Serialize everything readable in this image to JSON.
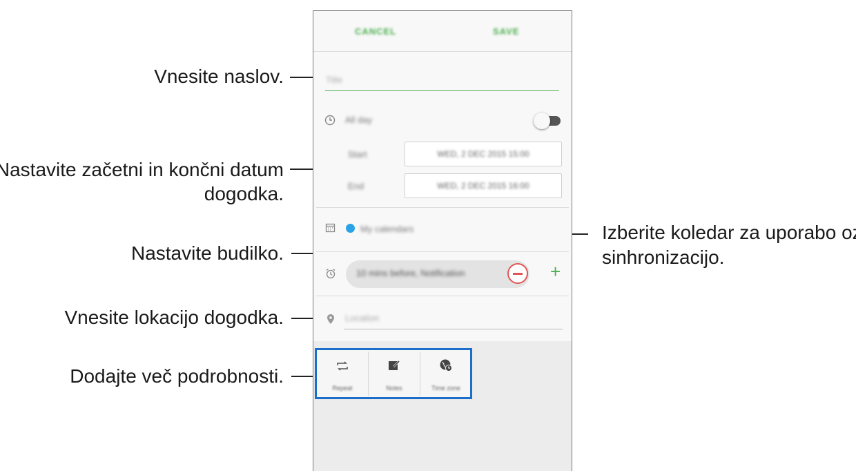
{
  "callouts": {
    "title": "Vnesite naslov.",
    "dates_line1": "Nastavite začetni in končni datum",
    "dates_line2": "dogodka.",
    "calendar_line1": "Izberite koledar za uporabo oz.",
    "calendar_line2": "sinhronizacijo.",
    "alarm": "Nastavite budilko.",
    "location": "Vnesite lokacijo dogodka.",
    "more": "Dodajte več podrobnosti."
  },
  "app": {
    "cancel_label": "CANCEL",
    "save_label": "SAVE",
    "title_placeholder": "Title",
    "all_day_label": "All day",
    "start_label": "Start",
    "end_label": "End",
    "start_value": "WED, 2 DEC 2015 15:00",
    "end_value": "WED, 2 DEC 2015 16:00",
    "calendar_label": "My calendars",
    "reminder_label": "10 mins before, Notification",
    "location_placeholder": "Location",
    "buttons": [
      {
        "label": "Repeat",
        "icon": "repeat-icon"
      },
      {
        "label": "Notes",
        "icon": "notes-icon"
      },
      {
        "label": "Time zone",
        "icon": "time-zone-icon"
      }
    ]
  },
  "colors": {
    "accent_green": "#4caf50",
    "calendar_dot": "#2aa2e6",
    "highlight_border": "#1b6fc9",
    "remove_red": "#e05656"
  }
}
